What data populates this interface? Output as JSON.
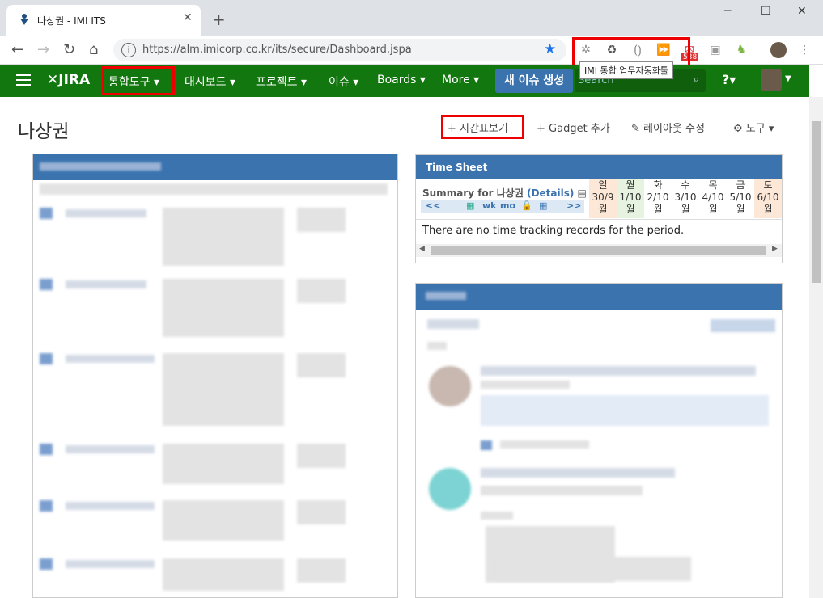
{
  "browser": {
    "tab_title": "나상권 - IMI ITS",
    "url": "https://alm.imicorp.co.kr/its/secure/Dashboard.jspa",
    "tooltip": "IMI 통합 업무자동화툴",
    "badge": "538"
  },
  "jira": {
    "logo": "JIRA",
    "menus": [
      "통합도구 ▾",
      "대시보드 ▾",
      "프로젝트 ▾",
      "이슈 ▾",
      "Boards ▾",
      "More ▾"
    ],
    "create": "새 이슈 생성",
    "search_placeholder": "Search",
    "help": "?▾"
  },
  "page": {
    "title": "나상권",
    "actions": [
      "+ 시간표보기",
      "+ Gadget 추가",
      "✎ 레이아웃 수정",
      "⚙ 도구 ▾"
    ]
  },
  "timesheet": {
    "title": "Time Sheet",
    "summary_prefix": "Summary for 나상권",
    "details": "(Details)",
    "nav": [
      "<<",
      "wk",
      "mo",
      ">>"
    ],
    "days": [
      {
        "name": "일",
        "date": "30/9",
        "month": "월"
      },
      {
        "name": "월",
        "date": "1/10",
        "month": "월"
      },
      {
        "name": "화",
        "date": "2/10",
        "month": "월"
      },
      {
        "name": "수",
        "date": "3/10",
        "month": "월"
      },
      {
        "name": "목",
        "date": "4/10",
        "month": "월"
      },
      {
        "name": "금",
        "date": "5/10",
        "month": "월"
      },
      {
        "name": "토",
        "date": "6/10",
        "month": "월"
      }
    ],
    "empty": "There are no time tracking records for the period."
  },
  "colors": {
    "header_green": "#13770f",
    "gadget_blue": "#3b73af",
    "highlight_red": "#ee0000"
  }
}
